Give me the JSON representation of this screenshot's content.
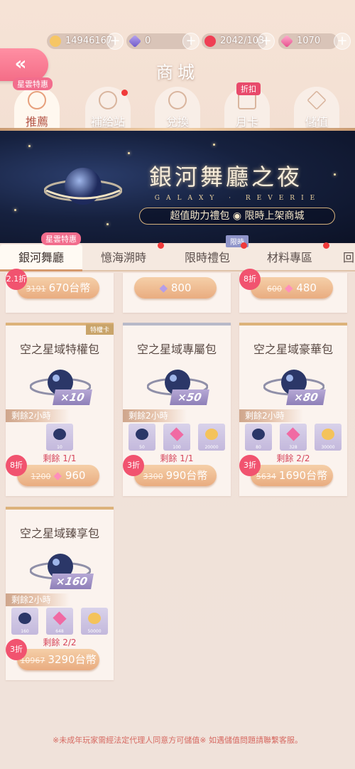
{
  "currency": [
    {
      "icon": "cat-coin-icon",
      "value": "14946167"
    },
    {
      "icon": "purple-diamond-icon",
      "value": "0"
    },
    {
      "icon": "heart-icon",
      "value": "2042/103"
    },
    {
      "icon": "pink-diamond-icon",
      "value": "1070"
    }
  ],
  "header": {
    "back_label": "«",
    "title": "商城"
  },
  "top_tabs": [
    {
      "label": "推薦",
      "badge": "星雲特惠",
      "icon": "star-bag-icon",
      "active": true
    },
    {
      "label": "補給站",
      "icon": "clock-icon",
      "dot": true
    },
    {
      "label": "兌換",
      "icon": "exchange-icon"
    },
    {
      "label": "月卡",
      "badge": "折扣",
      "icon": "calendar-icon"
    },
    {
      "label": "儲值",
      "icon": "diamond-icon"
    }
  ],
  "banner": {
    "title": "銀河舞廳之夜",
    "subtitle_en": "GALAXY · REVERIE",
    "tagline": "超值助力禮包 ◉ 限時上架商城"
  },
  "sub_tabs": [
    {
      "label": "銀河舞廳",
      "badge": "星雲特惠",
      "active": true
    },
    {
      "label": "憶海溯時",
      "dot": true
    },
    {
      "label": "限時禮包",
      "badge": "限時",
      "dot": true
    },
    {
      "label": "材料專區",
      "dot": true
    },
    {
      "label": "回"
    }
  ],
  "partial_row": [
    {
      "discount": "2.1折",
      "old_price": "3191",
      "price": "670台幣"
    },
    {
      "price": "800",
      "currency_icon": "purple-diamond-icon"
    },
    {
      "discount": "8折",
      "old_price": "600",
      "price": "480",
      "currency_icon": "pink-diamond-icon"
    }
  ],
  "packs": [
    {
      "name": "空之星域特權包",
      "multiplier": "×10",
      "timer": "剩餘2小時",
      "corner_badge": "特權卡",
      "items": [
        {
          "icon": "planet-item-icon",
          "count": "10"
        }
      ],
      "remaining": "剩餘 1/1",
      "discount": "8折",
      "old_price": "1200",
      "price": "960",
      "currency_icon": "pink-diamond-icon"
    },
    {
      "name": "空之星域專屬包",
      "multiplier": "×50",
      "timer": "剩餘2小時",
      "items": [
        {
          "icon": "planet-item-icon",
          "count": "50"
        },
        {
          "icon": "pink-diamond-icon",
          "count": "100"
        },
        {
          "icon": "gold-coin-icon",
          "count": "20000"
        }
      ],
      "remaining": "剩餘 1/1",
      "discount": "3折",
      "old_price": "3300",
      "price": "990台幣"
    },
    {
      "name": "空之星域豪華包",
      "multiplier": "×80",
      "timer": "剩餘2小時",
      "items": [
        {
          "icon": "planet-item-icon",
          "count": "80"
        },
        {
          "icon": "pink-diamond-icon",
          "count": "328"
        },
        {
          "icon": "gold-coin-icon",
          "count": "30000"
        }
      ],
      "remaining": "剩餘 2/2",
      "discount": "3折",
      "old_price": "5634",
      "price": "1690台幣"
    },
    {
      "name": "空之星域臻享包",
      "multiplier": "×160",
      "timer": "剩餘2小時",
      "items": [
        {
          "icon": "planet-item-icon",
          "count": "160"
        },
        {
          "icon": "pink-diamond-icon",
          "count": "648"
        },
        {
          "icon": "gold-coin-icon",
          "count": "50000"
        }
      ],
      "remaining": "剩餘 2/2",
      "discount": "3折",
      "old_price": "10967",
      "price": "3290台幣"
    }
  ],
  "footer": "※未成年玩家需經法定代理人同意方可儲值※ 如遇儲值問題請聯繫客服。",
  "colors": {
    "accent_pink": "#f26d8d",
    "button_peach": "#e9ac80",
    "discount_red": "#f1536f",
    "banner_navy": "#16213f"
  }
}
